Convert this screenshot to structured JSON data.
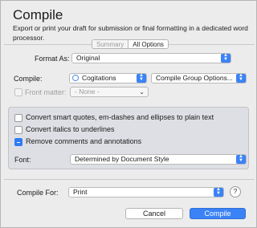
{
  "dialog": {
    "title": "Compile",
    "description": "Export or print your draft for submission or final formatting in a dedicated word processor."
  },
  "tabs": [
    {
      "label": "Summary",
      "selected": false
    },
    {
      "label": "All Options",
      "selected": true
    }
  ],
  "format_as": {
    "label": "Format As:",
    "value": "Original"
  },
  "compile": {
    "label": "Compile:",
    "value": "Cogitations",
    "group_options": "Compile Group Options..."
  },
  "front_matter": {
    "label": "Front matter:",
    "value": "- None -",
    "checked": false,
    "enabled": false
  },
  "options": [
    {
      "label": "Convert smart quotes, em-dashes and ellipses to plain text",
      "checked": false
    },
    {
      "label": "Convert italics to underlines",
      "checked": false
    },
    {
      "label": "Remove comments and annotations",
      "checked": "mixed"
    }
  ],
  "font": {
    "label": "Font:",
    "value": "Determined by Document Style"
  },
  "compile_for": {
    "label": "Compile For:",
    "value": "Print"
  },
  "help": {
    "label": "?"
  },
  "buttons": {
    "cancel": "Cancel",
    "compile": "Compile"
  },
  "colors": {
    "accent": "#3b82f6",
    "panel": "#dedfe4"
  }
}
